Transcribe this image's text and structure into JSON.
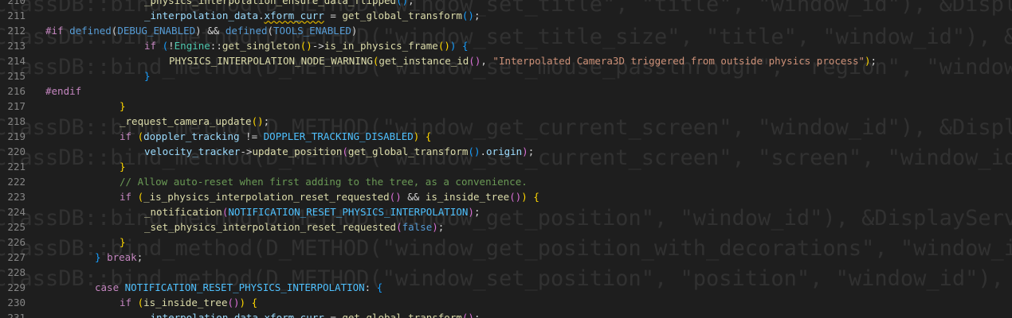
{
  "ghost": [
    "ClassDB::bind_method(D_METHOD(\"window_set_title\", \"title\", \"window_id\"), &DisplayServer::",
    "ClassDB::bind_method(D_METHOD(\"window_set_title_size\", \"title\", \"window_id\"), &DisplayServer",
    "ClassDB::bind_method(D_METHOD(\"window_set_mouse_passthrough\", \"region\", \"window_id\"), &Di",
    "ClassDB::bind_method(D_METHOD(\"window_get_current_screen\", \"window_id\"), &DisplayServer::",
    "ClassDB::bind_method(D_METHOD(\"window_set_current_screen\", \"screen\", \"window_id\"), &Displ",
    "ClassDB::bind_method(D_METHOD(\"window_get_position\", \"window_id\"), &DisplayServer::window",
    "ClassDB::bind_method(D_METHOD(\"window_get_position_with_decorations\", \"window_id\"), &Disp",
    "ClassDB::bind_method(D_METHOD(\"window_set_position\", \"position\", \"window_id\"), &DisplaySe"
  ],
  "lines": [
    {
      "n": "210",
      "indent": 4,
      "tokens": [
        {
          "t": "_physics_interpolation_ensure_data_flipped",
          "c": "fn"
        },
        {
          "t": "(",
          "c": "br3"
        },
        {
          "t": ")",
          "c": "br3"
        },
        {
          "t": ";",
          "c": "plain"
        }
      ]
    },
    {
      "n": "211",
      "indent": 4,
      "tokens": [
        {
          "t": "_interpolation_data",
          "c": "var"
        },
        {
          "t": ".",
          "c": "plain"
        },
        {
          "t": "xform_curr",
          "c": "var",
          "warn": true
        },
        {
          "t": " = ",
          "c": "plain"
        },
        {
          "t": "get_global_transform",
          "c": "fn"
        },
        {
          "t": "(",
          "c": "br3"
        },
        {
          "t": ")",
          "c": "br3"
        },
        {
          "t": ";",
          "c": "plain"
        }
      ]
    },
    {
      "n": "212",
      "indent": 0,
      "tokens": [
        {
          "t": "#if ",
          "c": "kw"
        },
        {
          "t": "defined",
          "c": "def"
        },
        {
          "t": "(",
          "c": "plain"
        },
        {
          "t": "DEBUG_ENABLED",
          "c": "def"
        },
        {
          "t": ")",
          "c": "plain"
        },
        {
          "t": " && ",
          "c": "plain"
        },
        {
          "t": "defined",
          "c": "def"
        },
        {
          "t": "(",
          "c": "plain"
        },
        {
          "t": "TOOLS_ENABLED",
          "c": "def"
        },
        {
          "t": ")",
          "c": "plain"
        }
      ]
    },
    {
      "n": "213",
      "indent": 4,
      "tokens": [
        {
          "t": "if ",
          "c": "kw"
        },
        {
          "t": "(",
          "c": "br3"
        },
        {
          "t": "!",
          "c": "plain"
        },
        {
          "t": "Engine",
          "c": "type"
        },
        {
          "t": "::",
          "c": "plain"
        },
        {
          "t": "get_singleton",
          "c": "fn"
        },
        {
          "t": "()",
          "c": "br"
        },
        {
          "t": "->",
          "c": "plain"
        },
        {
          "t": "is_in_physics_frame",
          "c": "fn"
        },
        {
          "t": "()",
          "c": "br"
        },
        {
          "t": ") ",
          "c": "br3"
        },
        {
          "t": "{",
          "c": "br3"
        }
      ]
    },
    {
      "n": "214",
      "indent": 5,
      "tokens": [
        {
          "t": "PHYSICS_INTERPOLATION_NODE_WARNING",
          "c": "fn"
        },
        {
          "t": "(",
          "c": "br"
        },
        {
          "t": "get_instance_id",
          "c": "fn"
        },
        {
          "t": "()",
          "c": "br2"
        },
        {
          "t": ", ",
          "c": "plain"
        },
        {
          "t": "\"Interpolated Camera3D triggered from outside physics process\"",
          "c": "str"
        },
        {
          "t": ")",
          "c": "br"
        },
        {
          "t": ";",
          "c": "plain"
        }
      ]
    },
    {
      "n": "215",
      "indent": 4,
      "tokens": [
        {
          "t": "}",
          "c": "br3"
        }
      ]
    },
    {
      "n": "216",
      "indent": 0,
      "tokens": [
        {
          "t": "#endif",
          "c": "kw"
        }
      ]
    },
    {
      "n": "217",
      "indent": 3,
      "tokens": [
        {
          "t": "}",
          "c": "br"
        }
      ]
    },
    {
      "n": "218",
      "indent": 3,
      "tokens": [
        {
          "t": "_request_camera_update",
          "c": "fn"
        },
        {
          "t": "(",
          "c": "br"
        },
        {
          "t": ")",
          "c": "br"
        },
        {
          "t": ";",
          "c": "plain"
        }
      ]
    },
    {
      "n": "219",
      "indent": 3,
      "tokens": [
        {
          "t": "if ",
          "c": "kw"
        },
        {
          "t": "(",
          "c": "br"
        },
        {
          "t": "doppler_tracking",
          "c": "var"
        },
        {
          "t": " != ",
          "c": "plain"
        },
        {
          "t": "DOPPLER_TRACKING_DISABLED",
          "c": "enum"
        },
        {
          "t": ") ",
          "c": "br"
        },
        {
          "t": "{",
          "c": "br"
        }
      ]
    },
    {
      "n": "220",
      "indent": 4,
      "tokens": [
        {
          "t": "velocity_tracker",
          "c": "var"
        },
        {
          "t": "->",
          "c": "plain"
        },
        {
          "t": "update_position",
          "c": "fn"
        },
        {
          "t": "(",
          "c": "br2"
        },
        {
          "t": "get_global_transform",
          "c": "fn"
        },
        {
          "t": "()",
          "c": "br3"
        },
        {
          "t": ".",
          "c": "plain"
        },
        {
          "t": "origin",
          "c": "var"
        },
        {
          "t": ")",
          "c": "br2"
        },
        {
          "t": ";",
          "c": "plain"
        }
      ]
    },
    {
      "n": "221",
      "indent": 3,
      "tokens": [
        {
          "t": "}",
          "c": "br"
        }
      ]
    },
    {
      "n": "222",
      "indent": 3,
      "tokens": [
        {
          "t": "// Allow auto-reset when first adding to the tree, as a convenience.",
          "c": "cmt"
        }
      ]
    },
    {
      "n": "223",
      "indent": 3,
      "tokens": [
        {
          "t": "if ",
          "c": "kw"
        },
        {
          "t": "(",
          "c": "br"
        },
        {
          "t": "_is_physics_interpolation_reset_requested",
          "c": "fn"
        },
        {
          "t": "()",
          "c": "br2"
        },
        {
          "t": " && ",
          "c": "plain"
        },
        {
          "t": "is_inside_tree",
          "c": "fn"
        },
        {
          "t": "()",
          "c": "br2"
        },
        {
          "t": ") ",
          "c": "br"
        },
        {
          "t": "{",
          "c": "br"
        }
      ]
    },
    {
      "n": "224",
      "indent": 4,
      "tokens": [
        {
          "t": "_notification",
          "c": "fn"
        },
        {
          "t": "(",
          "c": "br2"
        },
        {
          "t": "NOTIFICATION_RESET_PHYSICS_INTERPOLATION",
          "c": "enum"
        },
        {
          "t": ")",
          "c": "br2"
        },
        {
          "t": ";",
          "c": "plain"
        }
      ]
    },
    {
      "n": "225",
      "indent": 4,
      "tokens": [
        {
          "t": "_set_physics_interpolation_reset_requested",
          "c": "fn"
        },
        {
          "t": "(",
          "c": "br2"
        },
        {
          "t": "false",
          "c": "const"
        },
        {
          "t": ")",
          "c": "br2"
        },
        {
          "t": ";",
          "c": "plain"
        }
      ]
    },
    {
      "n": "226",
      "indent": 3,
      "tokens": [
        {
          "t": "}",
          "c": "br"
        }
      ]
    },
    {
      "n": "227",
      "indent": 2,
      "tokens": [
        {
          "t": "} ",
          "c": "br3"
        },
        {
          "t": "break",
          "c": "kw"
        },
        {
          "t": ";",
          "c": "plain"
        }
      ]
    },
    {
      "n": "228",
      "indent": 0,
      "tokens": []
    },
    {
      "n": "229",
      "indent": 2,
      "tokens": [
        {
          "t": "case ",
          "c": "kw"
        },
        {
          "t": "NOTIFICATION_RESET_PHYSICS_INTERPOLATION",
          "c": "enum"
        },
        {
          "t": ": ",
          "c": "plain"
        },
        {
          "t": "{",
          "c": "br3"
        }
      ]
    },
    {
      "n": "230",
      "indent": 3,
      "tokens": [
        {
          "t": "if ",
          "c": "kw"
        },
        {
          "t": "(",
          "c": "br"
        },
        {
          "t": "is_inside_tree",
          "c": "fn"
        },
        {
          "t": "()",
          "c": "br2"
        },
        {
          "t": ") ",
          "c": "br"
        },
        {
          "t": "{",
          "c": "br"
        }
      ]
    },
    {
      "n": "231",
      "indent": 4,
      "tokens": [
        {
          "t": "_interpolation_data",
          "c": "var"
        },
        {
          "t": ".",
          "c": "plain"
        },
        {
          "t": "xform_curr",
          "c": "var"
        },
        {
          "t": " = ",
          "c": "plain"
        },
        {
          "t": "get_global_transform",
          "c": "fn"
        },
        {
          "t": "()",
          "c": "br2"
        },
        {
          "t": ";",
          "c": "plain"
        }
      ]
    }
  ]
}
